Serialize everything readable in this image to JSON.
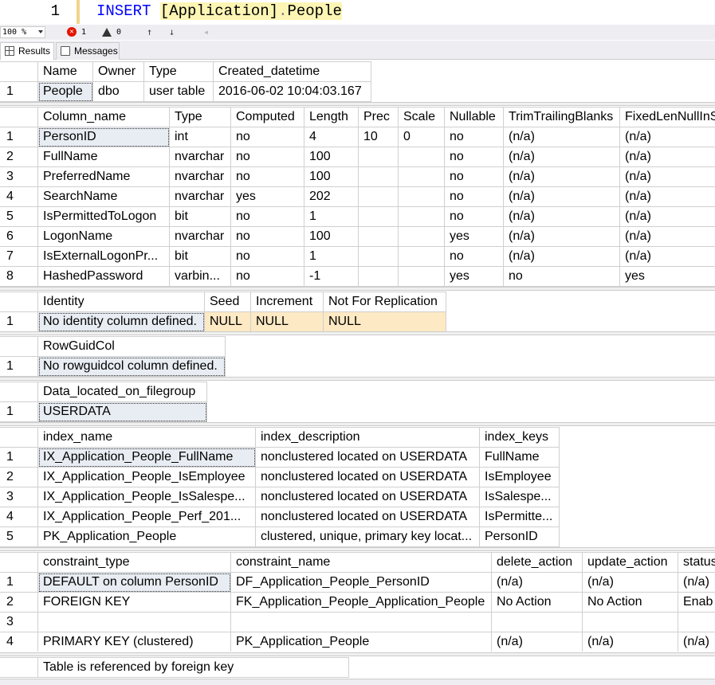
{
  "editor": {
    "line_number": "1",
    "keyword": "INSERT",
    "object_part1": "[Application]",
    "object_dot": ".",
    "object_part2": "People"
  },
  "status": {
    "zoom": "100 %",
    "errors": "1",
    "warnings": "0"
  },
  "tabs": {
    "results": "Results",
    "messages": "Messages"
  },
  "grid1": {
    "headers": [
      "Name",
      "Owner",
      "Type",
      "Created_datetime"
    ],
    "rows": [
      [
        "1",
        "People",
        "dbo",
        "user table",
        "2016-06-02 10:04:03.167"
      ]
    ]
  },
  "grid2": {
    "headers": [
      "Column_name",
      "Type",
      "Computed",
      "Length",
      "Prec",
      "Scale",
      "Nullable",
      "TrimTrailingBlanks",
      "FixedLenNullInS"
    ],
    "rows": [
      [
        "1",
        "PersonID",
        "int",
        "no",
        "4",
        "10",
        "0",
        "no",
        "(n/a)",
        "(n/a)"
      ],
      [
        "2",
        "FullName",
        "nvarchar",
        "no",
        "100",
        "",
        "",
        "no",
        "(n/a)",
        "(n/a)"
      ],
      [
        "3",
        "PreferredName",
        "nvarchar",
        "no",
        "100",
        "",
        "",
        "no",
        "(n/a)",
        "(n/a)"
      ],
      [
        "4",
        "SearchName",
        "nvarchar",
        "yes",
        "202",
        "",
        "",
        "no",
        "(n/a)",
        "(n/a)"
      ],
      [
        "5",
        "IsPermittedToLogon",
        "bit",
        "no",
        "1",
        "",
        "",
        "no",
        "(n/a)",
        "(n/a)"
      ],
      [
        "6",
        "LogonName",
        "nvarchar",
        "no",
        "100",
        "",
        "",
        "yes",
        "(n/a)",
        "(n/a)"
      ],
      [
        "7",
        "IsExternalLogonPr...",
        "bit",
        "no",
        "1",
        "",
        "",
        "no",
        "(n/a)",
        "(n/a)"
      ],
      [
        "8",
        "HashedPassword",
        "varbin...",
        "no",
        "-1",
        "",
        "",
        "yes",
        "no",
        "yes"
      ]
    ]
  },
  "grid3": {
    "headers": [
      "Identity",
      "Seed",
      "Increment",
      "Not For Replication"
    ],
    "rows": [
      [
        "1",
        "No identity column defined.",
        "NULL",
        "NULL",
        "NULL"
      ]
    ]
  },
  "grid4": {
    "headers": [
      "RowGuidCol"
    ],
    "rows": [
      [
        "1",
        "No rowguidcol column defined."
      ]
    ]
  },
  "grid5": {
    "headers": [
      "Data_located_on_filegroup"
    ],
    "rows": [
      [
        "1",
        "USERDATA"
      ]
    ]
  },
  "grid6": {
    "headers": [
      "index_name",
      "index_description",
      "index_keys"
    ],
    "rows": [
      [
        "1",
        "IX_Application_People_FullName",
        "nonclustered located on USERDATA",
        "FullName"
      ],
      [
        "2",
        "IX_Application_People_IsEmployee",
        "nonclustered located on USERDATA",
        "IsEmployee"
      ],
      [
        "3",
        "IX_Application_People_IsSalespe...",
        "nonclustered located on USERDATA",
        "IsSalespe..."
      ],
      [
        "4",
        "IX_Application_People_Perf_201...",
        "nonclustered located on USERDATA",
        "IsPermitte..."
      ],
      [
        "5",
        "PK_Application_People",
        "clustered, unique, primary key locat...",
        "PersonID"
      ]
    ]
  },
  "grid7": {
    "headers": [
      "constraint_type",
      "constraint_name",
      "delete_action",
      "update_action",
      "status"
    ],
    "rows": [
      [
        "1",
        "DEFAULT on column PersonID",
        "DF_Application_People_PersonID",
        "(n/a)",
        "(n/a)",
        "(n/a)"
      ],
      [
        "2",
        "FOREIGN KEY",
        "FK_Application_People_Application_People",
        "No Action",
        "No Action",
        "Enab"
      ],
      [
        "3",
        "",
        "",
        "",
        "",
        ""
      ],
      [
        "4",
        "PRIMARY KEY (clustered)",
        "PK_Application_People",
        "(n/a)",
        "(n/a)",
        "(n/a)"
      ]
    ]
  },
  "grid8": {
    "headers": [
      "Table is referenced by foreign key"
    ]
  }
}
